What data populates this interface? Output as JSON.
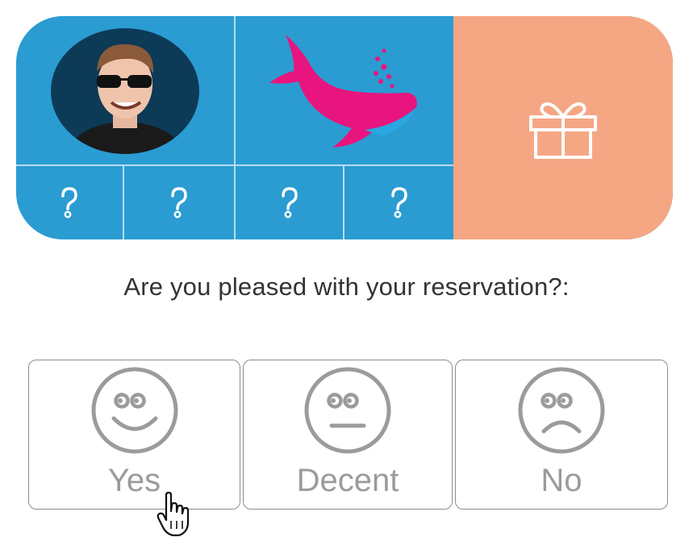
{
  "header_card": {
    "avatar_icon": "person-photo-icon",
    "logo_icon": "whale-logo-icon",
    "gift_icon": "gift-icon",
    "question_icon": "question-mark-icon",
    "colors": {
      "blue": "#2a9cd2",
      "peach": "#f5a784",
      "whale_pink": "#e8157e"
    }
  },
  "survey": {
    "prompt": "Are you pleased with your reservation?:",
    "options": [
      {
        "label": "Yes",
        "icon": "smiley-happy-icon"
      },
      {
        "label": "Decent",
        "icon": "smiley-neutral-icon"
      },
      {
        "label": "No",
        "icon": "smiley-sad-icon"
      }
    ]
  },
  "cursor_icon": "hand-pointer-icon"
}
